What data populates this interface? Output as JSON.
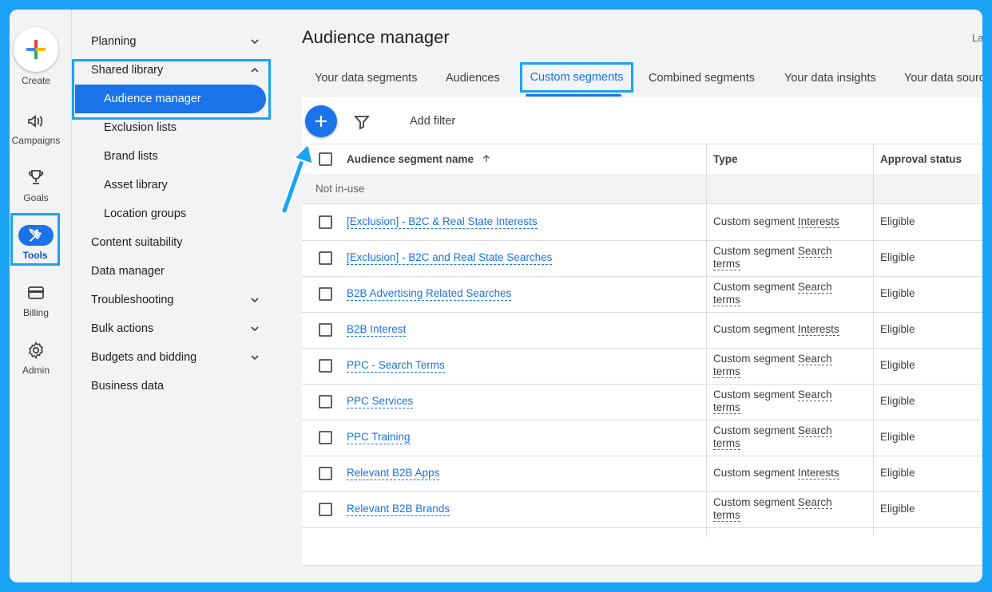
{
  "rail": {
    "create": "Create",
    "campaigns": "Campaigns",
    "goals": "Goals",
    "tools": "Tools",
    "billing": "Billing",
    "admin": "Admin"
  },
  "nav": {
    "planning": "Planning",
    "shared_library": "Shared library",
    "audience_manager": "Audience manager",
    "exclusion_lists": "Exclusion lists",
    "brand_lists": "Brand lists",
    "asset_library": "Asset library",
    "location_groups": "Location groups",
    "content_suitability": "Content suitability",
    "data_manager": "Data manager",
    "troubleshooting": "Troubleshooting",
    "bulk_actions": "Bulk actions",
    "budgets_bidding": "Budgets and bidding",
    "business_data": "Business data"
  },
  "page": {
    "title": "Audience manager",
    "title_trail": "La"
  },
  "tabs": {
    "your_data_segments": "Your data segments",
    "audiences": "Audiences",
    "custom_segments": "Custom segments",
    "combined_segments": "Combined segments",
    "your_data_insights": "Your data insights",
    "your_data_sources": "Your data source"
  },
  "toolbar": {
    "add_filter": "Add filter"
  },
  "table": {
    "headers": {
      "name": "Audience segment name",
      "type": "Type",
      "status": "Approval status"
    },
    "group_label": "Not in-use",
    "type_prefix": "Custom segment",
    "rows": [
      {
        "name": "[Exclusion] - B2C & Real State Interests",
        "kind": "Interests",
        "status": "Eligible"
      },
      {
        "name": "[Exclusion] - B2C and Real State Searches",
        "kind": "Search terms",
        "status": "Eligible"
      },
      {
        "name": "B2B Advertising Related Searches",
        "kind": "Search terms",
        "status": "Eligible"
      },
      {
        "name": "B2B Interest",
        "kind": "Interests",
        "status": "Eligible"
      },
      {
        "name": "PPC - Search Terms",
        "kind": "Search terms",
        "status": "Eligible"
      },
      {
        "name": "PPC Services",
        "kind": "Search terms",
        "status": "Eligible"
      },
      {
        "name": "PPC Training",
        "kind": "Search terms",
        "status": "Eligible"
      },
      {
        "name": "Relevant B2B Apps",
        "kind": "Interests",
        "status": "Eligible"
      },
      {
        "name": "Relevant B2B Brands",
        "kind": "Search terms",
        "status": "Eligible"
      }
    ]
  },
  "colors": {
    "accent": "#1a73e8",
    "highlight": "#1aa3f5"
  },
  "icons": {
    "create": "plus-multicolor-icon",
    "campaigns": "megaphone-icon",
    "goals": "trophy-icon",
    "tools": "wrench-screwdriver-icon",
    "billing": "credit-card-icon",
    "admin": "gear-icon",
    "add": "plus-icon",
    "filter": "funnel-icon",
    "sort": "arrow-up-icon",
    "annotation": "pointer-arrow-icon"
  }
}
